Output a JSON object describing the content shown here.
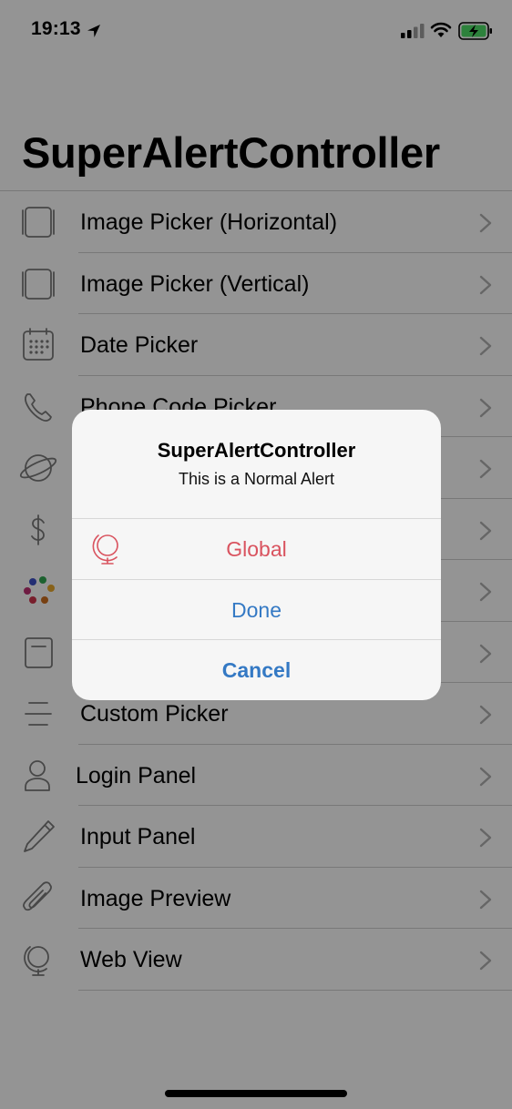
{
  "status_bar": {
    "time": "19:13",
    "icons": [
      "location-arrow-icon",
      "cellular-signal-icon",
      "wifi-icon",
      "battery-charging-icon"
    ]
  },
  "nav": {
    "title": "SuperAlertController"
  },
  "list": {
    "items": [
      {
        "label": "Image Picker (Horizontal)",
        "icon": "image-frame-horizontal-icon"
      },
      {
        "label": "Image Picker (Vertical)",
        "icon": "image-frame-vertical-icon"
      },
      {
        "label": "Date Picker",
        "icon": "calendar-icon"
      },
      {
        "label": "Phone Code Picker",
        "icon": "phone-icon"
      },
      {
        "label": "",
        "icon": "planet-icon"
      },
      {
        "label": "",
        "icon": "dollar-icon"
      },
      {
        "label": "",
        "icon": "color-dots-icon"
      },
      {
        "label": "",
        "icon": "document-icon"
      },
      {
        "label": "Custom Picker",
        "icon": "lines-icon"
      },
      {
        "label": "Login Panel",
        "icon": "person-icon"
      },
      {
        "label": "Input Panel",
        "icon": "pencil-icon"
      },
      {
        "label": "Image Preview",
        "icon": "paperclip-icon"
      },
      {
        "label": "Web View",
        "icon": "globe-icon"
      }
    ]
  },
  "alert": {
    "title": "SuperAlertController",
    "message": "This is a Normal Alert",
    "actions": [
      {
        "label": "Global",
        "style": "destructive",
        "icon": "globe-icon",
        "color": "#d9535f"
      },
      {
        "label": "Done",
        "style": "default",
        "color": "#3479c4"
      },
      {
        "label": "Cancel",
        "style": "cancel",
        "color": "#3479c4"
      }
    ]
  },
  "colors": {
    "tint": "#3479c4",
    "destructive": "#d9535f",
    "battery_green": "#4cd964"
  }
}
